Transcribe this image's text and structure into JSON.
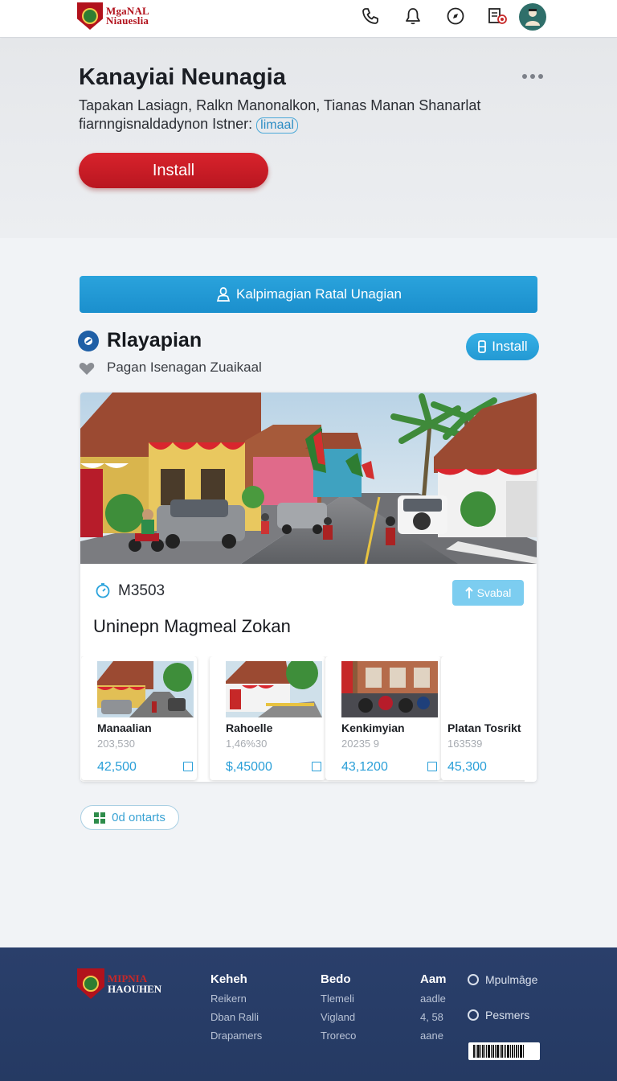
{
  "nav": {
    "logo_line1": "MgaNAL",
    "logo_line2": "Niaueslia",
    "icons": [
      "phone-icon",
      "bell-icon",
      "compass-icon",
      "document-icon"
    ]
  },
  "hero": {
    "title": "Kanayiai Neunagia",
    "subtitle": "Tapakan Lasiagn, Ralkn Manonalkon, Tianas Manan Shanarlat fiarnngisnaldadynon Istner:",
    "chip": "limaal",
    "install_label": "Install",
    "accent": "#d01f27"
  },
  "banner": {
    "label": "Kalpimagian Ratal Unagian"
  },
  "app": {
    "name": "Rlayapian",
    "subtitle": "Pagan Isenagan Zuaikaal",
    "install_label": "Install",
    "accent": "#2aa3dc"
  },
  "card": {
    "meta": "M3503",
    "search_label": "Svabal",
    "heading": "Uninepn Magmeal Zokan"
  },
  "tiles": [
    {
      "name": "Manaalian",
      "sub": "203,530",
      "price": "42,500"
    },
    {
      "name": "Rahoelle",
      "sub": "1,46%30",
      "price": "$,45000"
    },
    {
      "name": "Kenkimyian",
      "sub": "20235 9",
      "price": "43,1200"
    },
    {
      "name": "Platan Tosrikt",
      "sub": "163539",
      "price": "45,300"
    }
  ],
  "contacts": {
    "label": "0d ontarts"
  },
  "footer": {
    "logo_line1": "MIPNIA",
    "logo_line2": "HAOUHEN",
    "columns": [
      {
        "head": "Keheh",
        "links": [
          "Reikern",
          "Dban Ralli",
          "Drapamers"
        ]
      },
      {
        "head": "Bedo",
        "links": [
          "Tlemeli",
          "Vigland",
          "Troreco"
        ]
      },
      {
        "head": "Aam",
        "links": [
          "aadle",
          "4, 58",
          "aane"
        ]
      }
    ],
    "radios": [
      "Mpulmâge",
      "Pesmers"
    ]
  }
}
